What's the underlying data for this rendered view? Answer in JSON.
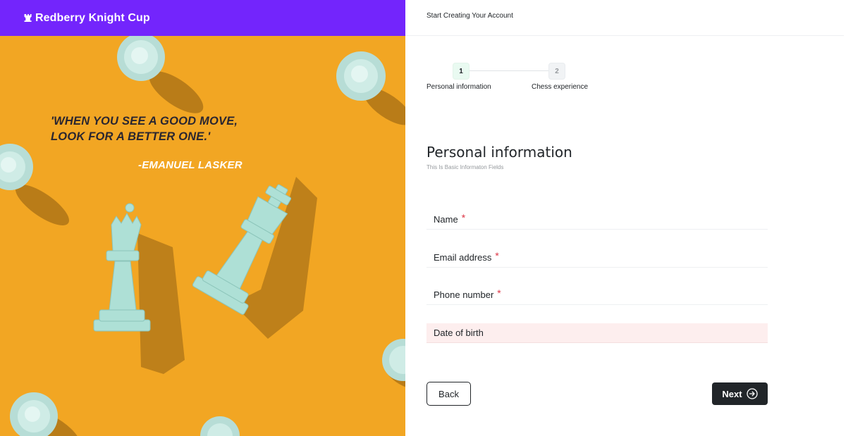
{
  "brand": {
    "title": "Redberry Knight Cup",
    "icon": "chess-rook-icon",
    "bar_color": "#7325fc"
  },
  "hero": {
    "background_color": "#f2a623",
    "quote_line_1": "'WHEN YOU SEE A GOOD MOVE,",
    "quote_line_2": "LOOK FOR A BETTER ONE.'",
    "author": "-EMANUEL LASKER"
  },
  "header": {
    "title": "Start Creating Your Account"
  },
  "stepper": {
    "steps": [
      {
        "number": "1",
        "label": "Personal information"
      },
      {
        "number": "2",
        "label": "Chess experience"
      }
    ]
  },
  "form": {
    "title": "Personal information",
    "subtitle": "This Is Basic Informaton Fields",
    "fields": [
      {
        "label": "Name",
        "required_mark": "*"
      },
      {
        "label": "Email address",
        "required_mark": "*"
      },
      {
        "label": "Phone number",
        "required_mark": "*"
      },
      {
        "label": "Date of birth"
      }
    ],
    "error_fill_color": "#fdeeee"
  },
  "actions": {
    "back_label": "Back",
    "next_label": "Next",
    "next_icon": "arrow-right-circle-icon"
  }
}
